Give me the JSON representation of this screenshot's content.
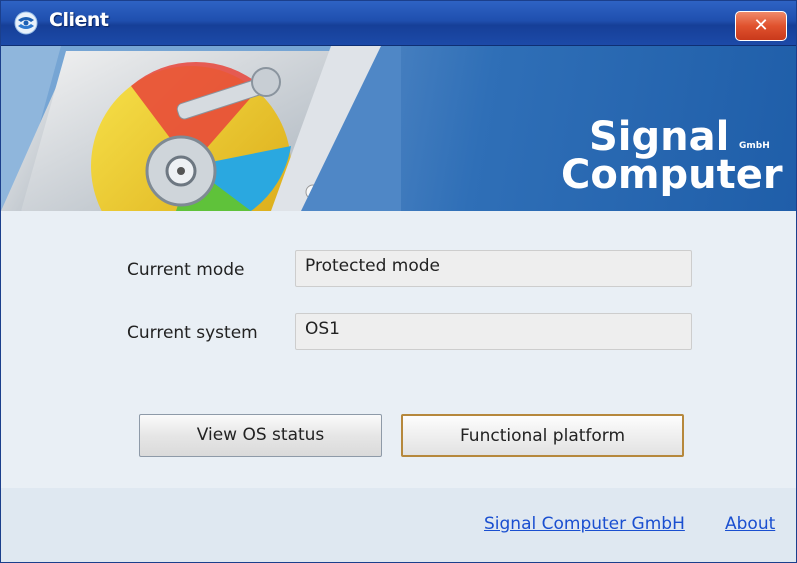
{
  "window": {
    "title": "Client",
    "close_label": "✕"
  },
  "banner": {
    "logo_line1": "Signal",
    "logo_gmbh": "GmbH",
    "logo_line2": "Computer"
  },
  "form": {
    "current_mode_label": "Current mode",
    "current_mode_value": "Protected mode",
    "current_system_label": "Current system",
    "current_system_value": "OS1"
  },
  "buttons": {
    "view_os_status": "View OS status",
    "functional_platform": "Functional platform"
  },
  "footer": {
    "company_link": "Signal Computer GmbH",
    "about_link": "About"
  }
}
